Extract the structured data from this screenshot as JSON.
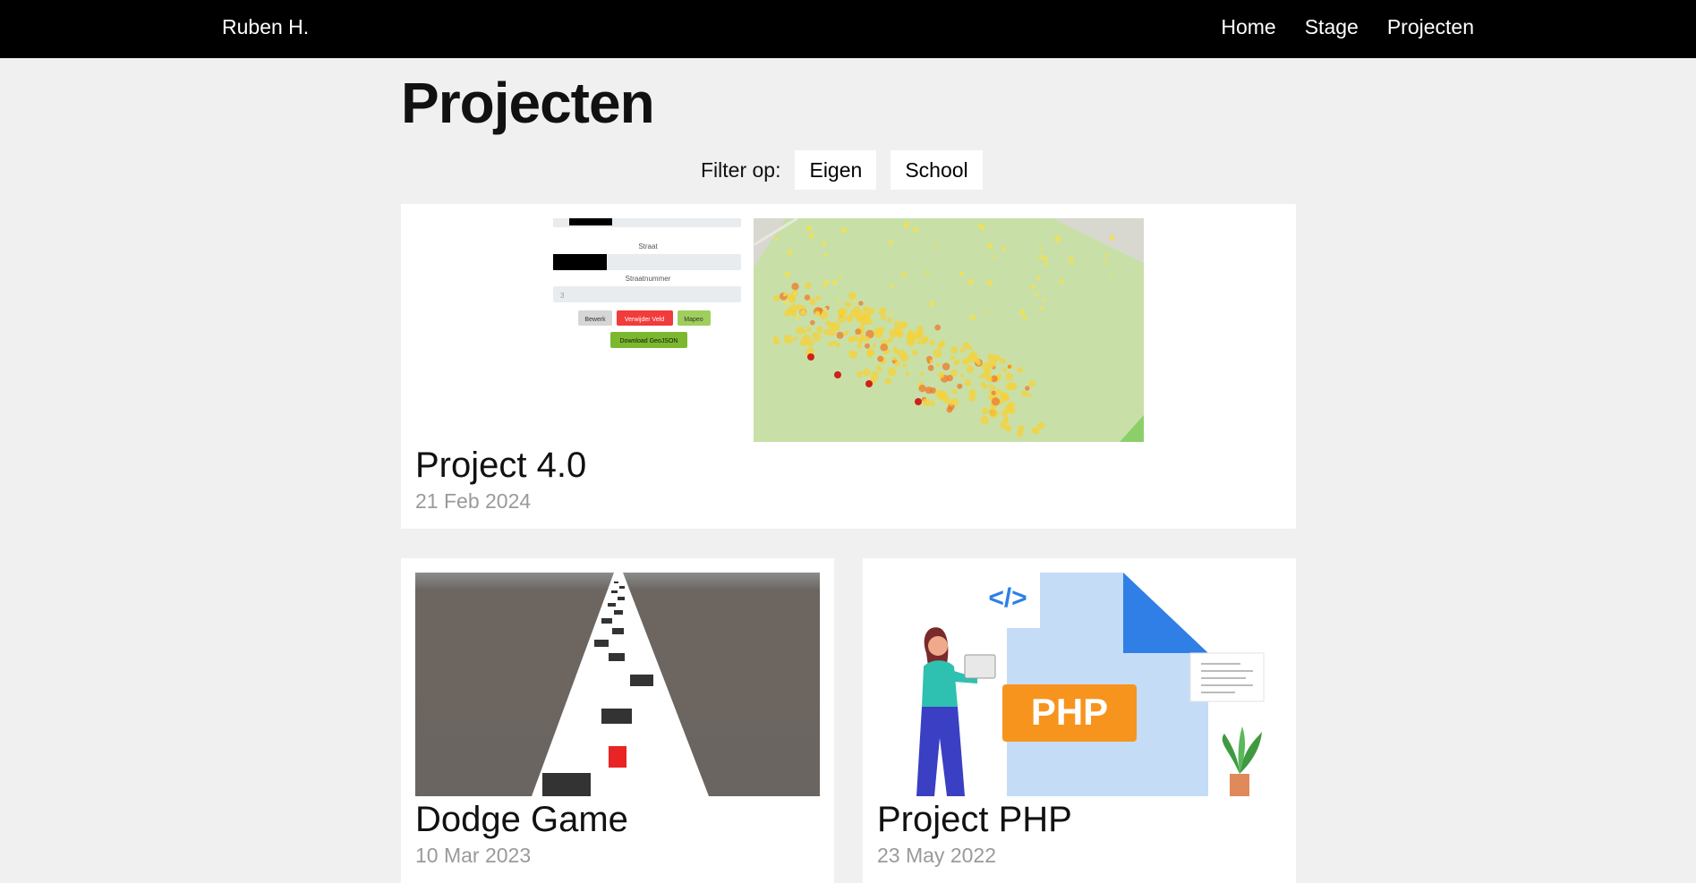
{
  "nav": {
    "brand": "Ruben H.",
    "links": [
      "Home",
      "Stage",
      "Projecten"
    ]
  },
  "page": {
    "title": "Projecten"
  },
  "filter": {
    "label": "Filter op:",
    "options": [
      "Eigen",
      "School"
    ]
  },
  "projects": [
    {
      "title": "Project 4.0",
      "date": "21 Feb 2024",
      "form": {
        "field1": "Straat",
        "field2": "Straatnummer",
        "buttons": [
          "Bewerk",
          "Verwijder Veld",
          "Mapeo"
        ],
        "download": "Download GeoJSON"
      }
    },
    {
      "title": "Dodge Game",
      "date": "10 Mar 2023"
    },
    {
      "title": "Project PHP",
      "date": "23 May 2022",
      "badge": "PHP",
      "code_tag": "</>"
    }
  ],
  "colors": {
    "navbar": "#000000",
    "background": "#f0f0f0",
    "card": "#ffffff",
    "date": "#9a9a9a",
    "php_badge": "#f7941d",
    "red_button": "#f23b3b",
    "green_button": "#7cb82f"
  }
}
